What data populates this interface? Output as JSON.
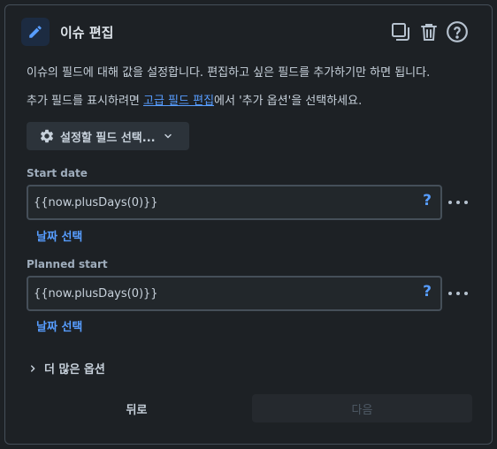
{
  "dialog": {
    "title": "이슈 편집",
    "header_icons": [
      "duplicate-icon",
      "trash-icon",
      "help-circle-icon"
    ],
    "description_1": "이슈의 필드에 대해 값을 설정합니다. 편집하고 싶은 필드를 추가하기만 하면 됩니다.",
    "description_2_before": "추가 필드를 표시하려면 ",
    "description_2_link": "고급 필드 편집",
    "description_2_after": "에서 '추가 옵션'을 선택하세요.",
    "field_select_label": "설정할 필드 선택..."
  },
  "fields": [
    {
      "label": "Start date",
      "value": "{{now.plusDays(0)}}",
      "help": "?",
      "date_link": "날짜 선택"
    },
    {
      "label": "Planned start",
      "value": "{{now.plusDays(0)}}",
      "help": "?",
      "date_link": "날짜 선택"
    }
  ],
  "more_options_label": "더 많은 옵션",
  "footer": {
    "back_label": "뒤로",
    "next_label": "다음"
  },
  "colors": {
    "accent": "#579dff",
    "background": "#1d2125",
    "field_border": "#454f59"
  }
}
